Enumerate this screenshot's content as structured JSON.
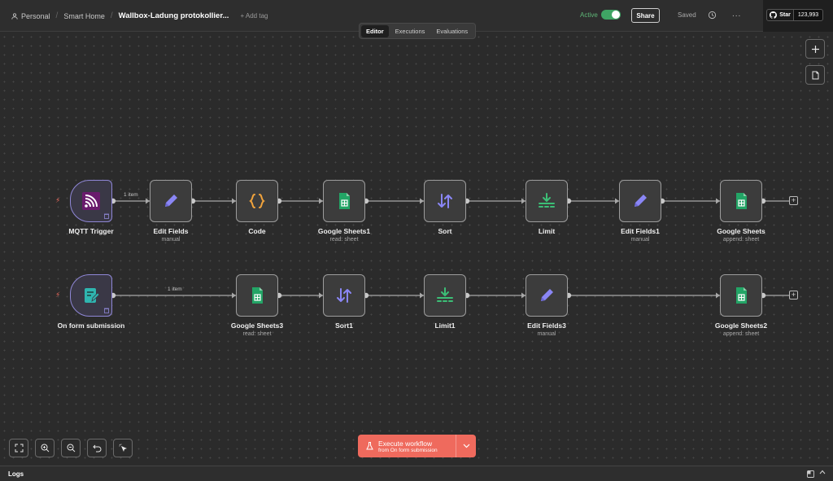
{
  "header": {
    "project": "Personal",
    "folder": "Smart Home",
    "workflow_title": "Wallbox-Ladung protokollier...",
    "add_tag": "+ Add tag",
    "active_label": "Active",
    "share_label": "Share",
    "saved_label": "Saved",
    "more_label": "...",
    "github_star": "Star",
    "github_count": "123,993"
  },
  "tabs": [
    {
      "label": "Editor",
      "active": true
    },
    {
      "label": "Executions",
      "active": false
    },
    {
      "label": "Evaluations",
      "active": false
    }
  ],
  "nodes": {
    "row1": [
      {
        "label": "MQTT Trigger",
        "sub": "",
        "icon": "mqtt-icon"
      },
      {
        "label": "Edit Fields",
        "sub": "manual",
        "icon": "pencil-icon"
      },
      {
        "label": "Code",
        "sub": "",
        "icon": "code-braces-icon"
      },
      {
        "label": "Google Sheets1",
        "sub": "read: sheet",
        "icon": "google-sheets-icon"
      },
      {
        "label": "Sort",
        "sub": "",
        "icon": "sort-arrows-icon"
      },
      {
        "label": "Limit",
        "sub": "",
        "icon": "limit-icon"
      },
      {
        "label": "Edit Fields1",
        "sub": "manual",
        "icon": "pencil-icon"
      },
      {
        "label": "Google Sheets",
        "sub": "append: sheet",
        "icon": "google-sheets-icon"
      }
    ],
    "row2": [
      {
        "label": "On form submission",
        "sub": "",
        "icon": "form-icon"
      },
      {
        "label": "Google Sheets3",
        "sub": "read: sheet",
        "icon": "google-sheets-icon"
      },
      {
        "label": "Sort1",
        "sub": "",
        "icon": "sort-arrows-icon"
      },
      {
        "label": "Limit1",
        "sub": "",
        "icon": "limit-icon"
      },
      {
        "label": "Edit Fields3",
        "sub": "manual",
        "icon": "pencil-icon"
      },
      {
        "label": "Google Sheets2",
        "sub": "append: sheet",
        "icon": "google-sheets-icon"
      }
    ]
  },
  "edge_labels": {
    "row1": "1 item",
    "row2": "1 item"
  },
  "plus_label": "+",
  "execute": {
    "title": "Execute workflow",
    "subtitle": "from On form submission"
  },
  "logs": {
    "label": "Logs"
  },
  "colors": {
    "accent": "#ef6a5d",
    "active_green": "#3fa564",
    "sheets_green": "#23a566",
    "trigger_purple": "#8f87d6",
    "pencil_purple": "#8a86f5",
    "code_orange": "#f0a33c"
  }
}
